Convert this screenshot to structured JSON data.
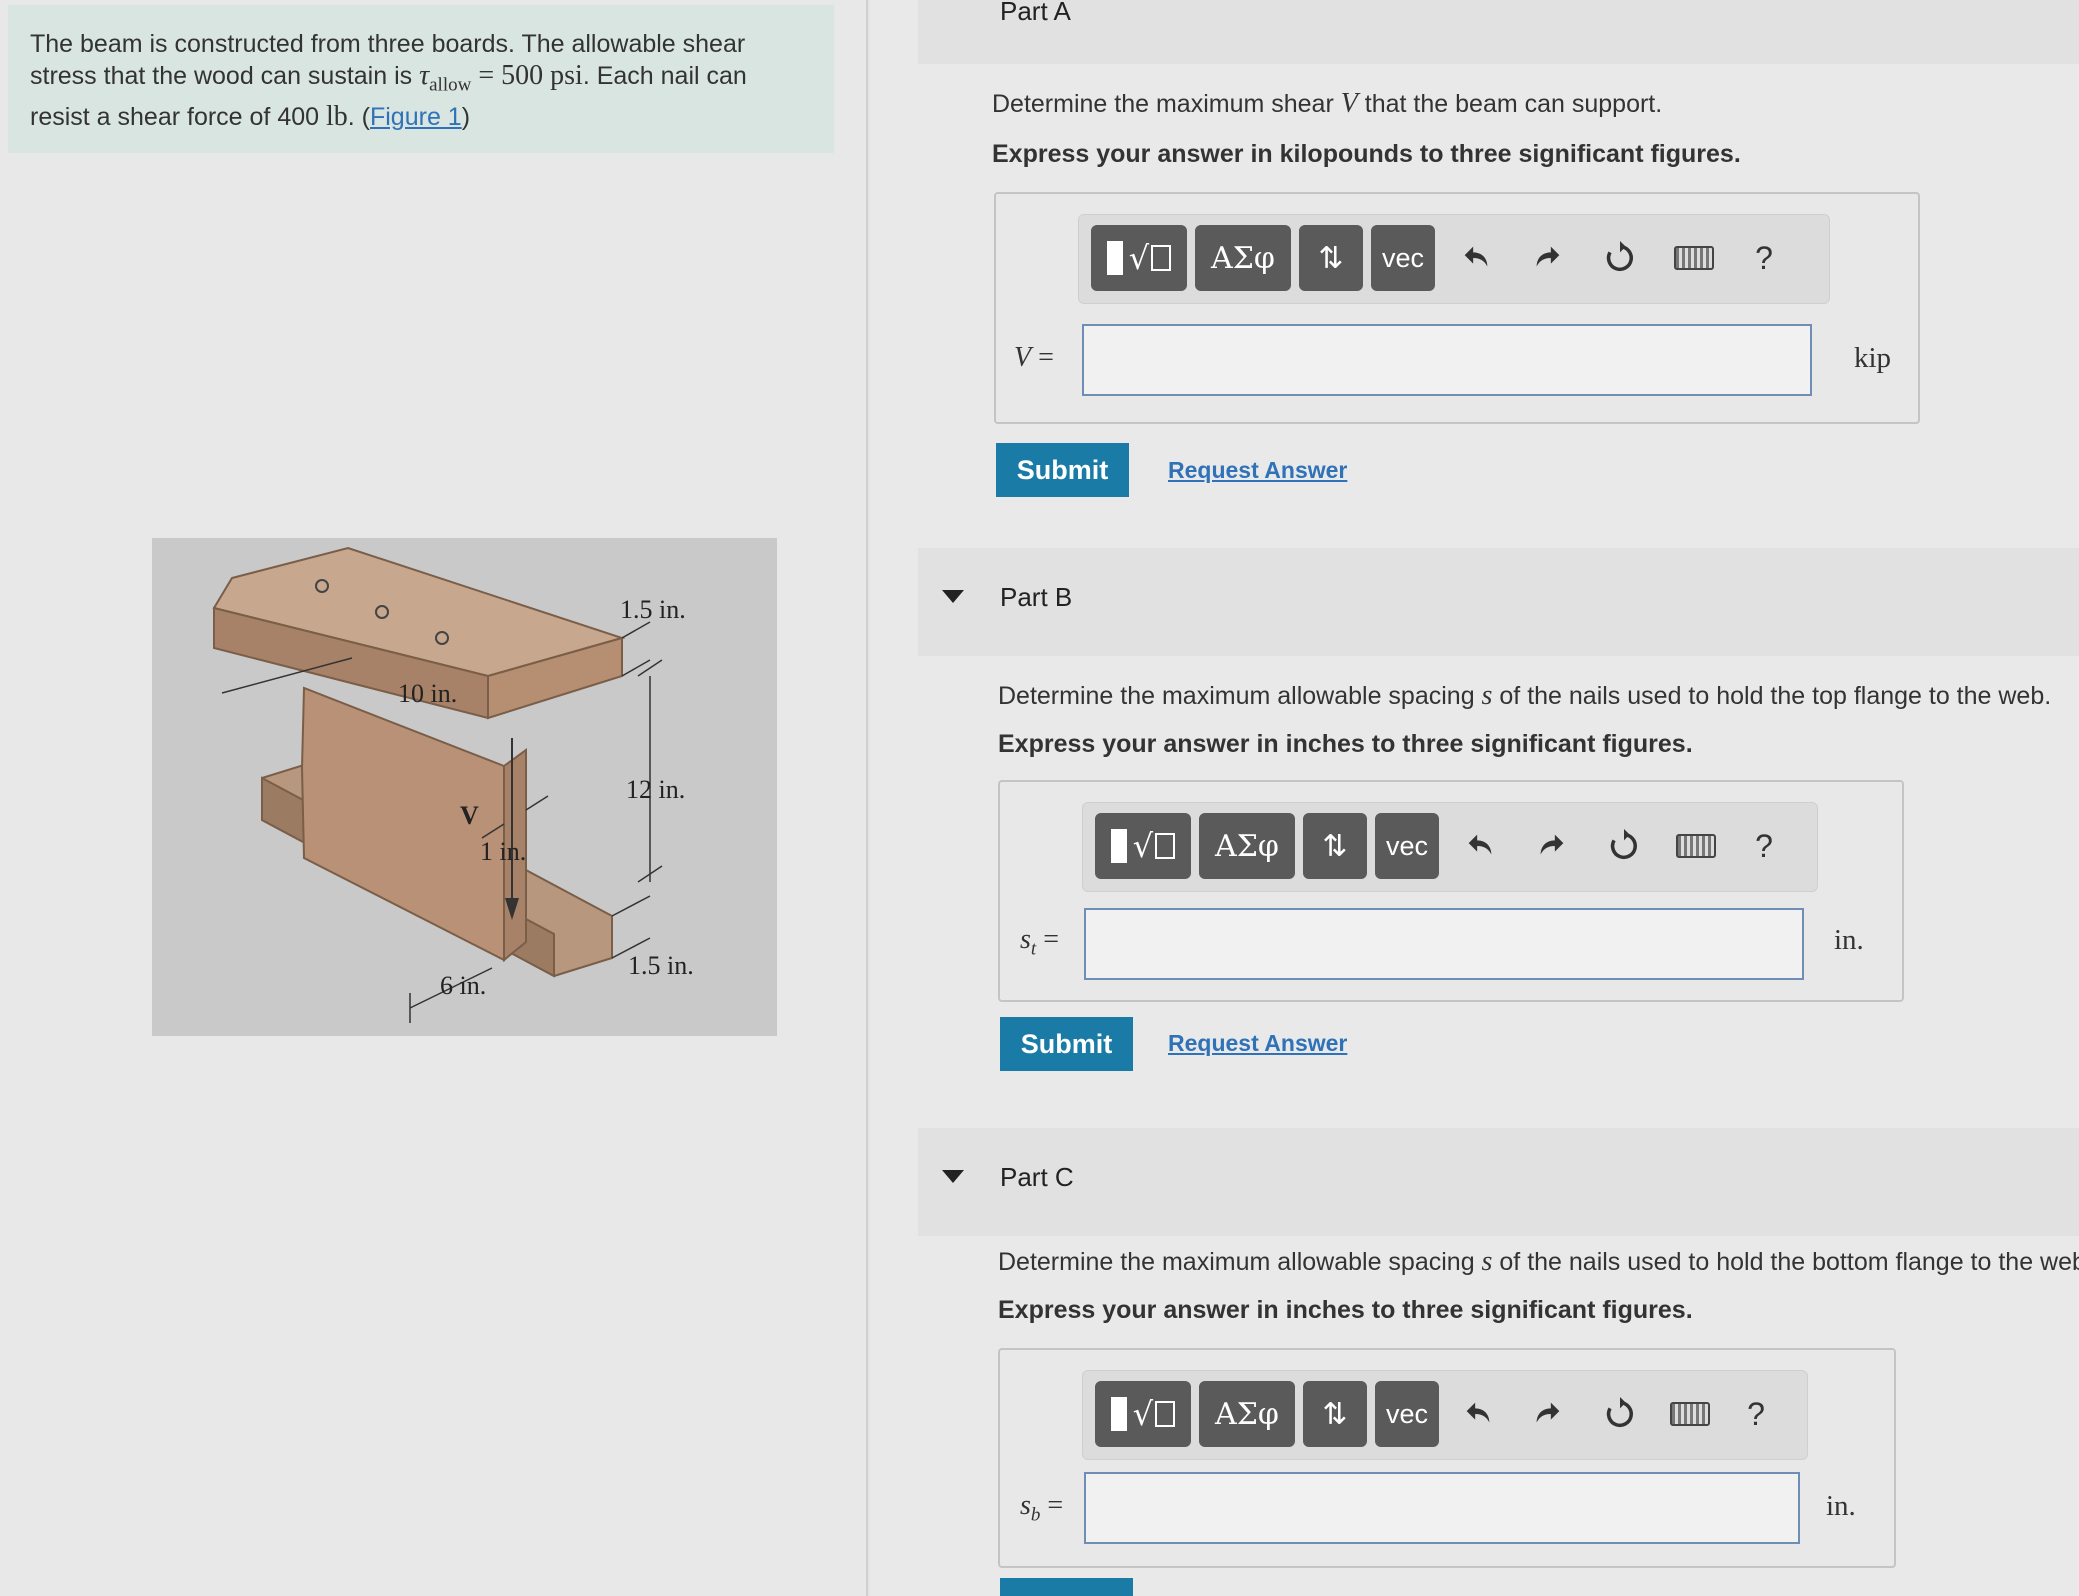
{
  "problem": {
    "text_1": "The beam is constructed from three boards. The allowable shear",
    "text_2a": "stress that the wood can sustain is ",
    "tau": "τ",
    "tau_sub": "allow",
    "eq": " = 500 psi",
    "text_2b": ". Each nail can",
    "text_3a": "resist a shear force of 400 ",
    "unit_lb": "lb",
    "text_3b": ". (",
    "figure_link": "Figure 1",
    "text_3c": ")"
  },
  "figure": {
    "labels": {
      "top_flange_thickness": "1.5 in.",
      "flange_width": "10 in.",
      "web_height": "12 in.",
      "shear": "V",
      "web_thickness": "1 in.",
      "bottom_flange_thickness": "1.5 in.",
      "bottom_flange_width": "6 in."
    }
  },
  "part_a": {
    "title": "Part A",
    "question_a": "Determine the maximum shear ",
    "question_var": "V",
    "question_b": " that the beam can support.",
    "instruction": "Express your answer in kilopounds to three significant figures.",
    "var_label": "V",
    "equals": " =",
    "unit": "kip",
    "submit": "Submit",
    "request": "Request Answer"
  },
  "part_b": {
    "title": "Part B",
    "question_a": "Determine the maximum allowable spacing ",
    "question_var": "s",
    "question_b": " of the nails used to hold the top flange to the web.",
    "instruction": "Express your answer in inches to three significant figures.",
    "var_label": "s",
    "var_sub": "t",
    "equals": " =",
    "unit": "in.",
    "submit": "Submit",
    "request": "Request Answer"
  },
  "part_c": {
    "title": "Part C",
    "question_a": "Determine the maximum allowable spacing ",
    "question_var": "s",
    "question_b": " of the nails used to hold the bottom flange to the web",
    "instruction": "Express your answer in inches to three significant figures.",
    "var_label": "s",
    "var_sub": "b",
    "equals": " =",
    "unit": "in."
  },
  "toolbar": {
    "greek": "ΑΣφ",
    "arrows": "⇅",
    "vec": "vec",
    "help": "?",
    "icons": [
      "templates-icon",
      "greek-icon",
      "arrows-icon",
      "vec-icon",
      "undo-icon",
      "redo-icon",
      "reset-icon",
      "keyboard-icon",
      "help-icon"
    ]
  }
}
